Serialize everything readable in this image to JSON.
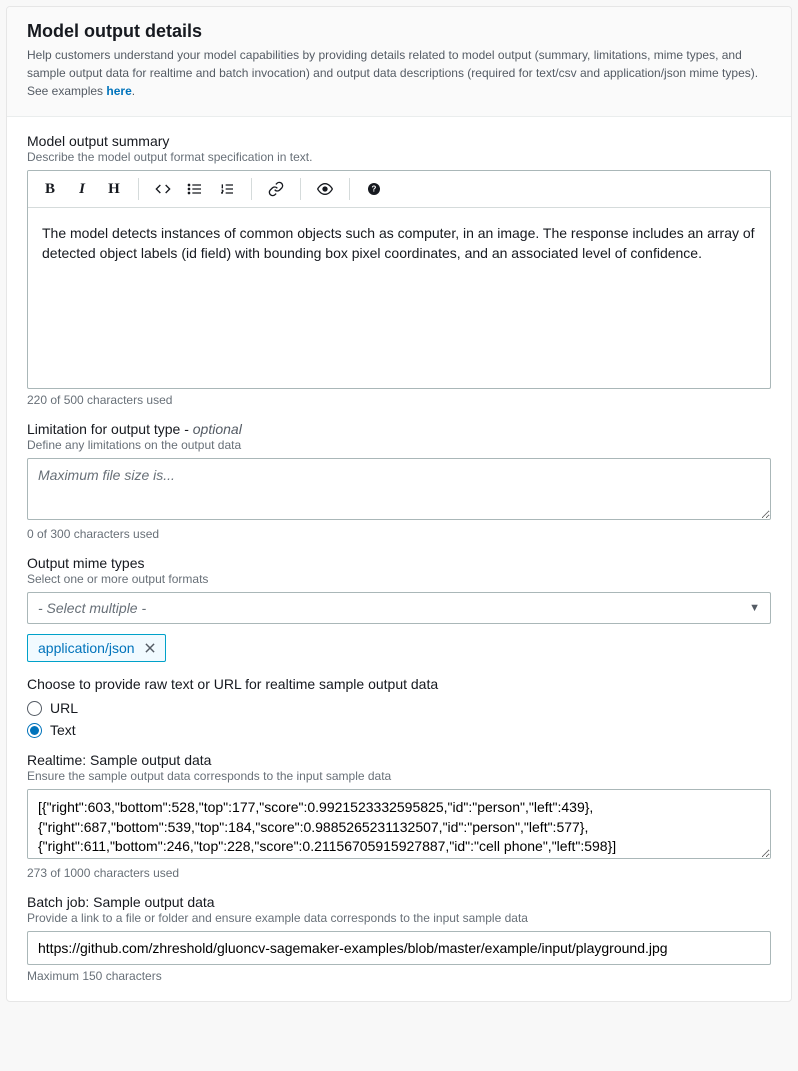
{
  "header": {
    "title": "Model output details",
    "desc_pre": "Help customers understand your model capabilities by providing details related to model output (summary, limitations, mime types, and sample output data for realtime and batch invocation) and output data descriptions (required for text/csv and application/json mime types). See examples ",
    "link": "here",
    "desc_post": "."
  },
  "summary": {
    "label": "Model output summary",
    "hint": "Describe the model output format specification in text.",
    "value": "The model detects instances of common objects such as computer, in an image. The response includes an array of detected object labels (id field) with bounding box pixel coordinates, and an associated level of confidence.",
    "count": "220 of 500 characters used"
  },
  "limitation": {
    "label_pre": "Limitation for output type - ",
    "optional": "optional",
    "hint": "Define any limitations on the output data",
    "placeholder": "Maximum file size is...",
    "count": "0 of 300 characters used"
  },
  "mime": {
    "label": "Output mime types",
    "hint": "Select one or more output formats",
    "placeholder": "- Select multiple -",
    "selected": "application/json"
  },
  "source": {
    "label": "Choose to provide raw text or URL for realtime sample output data",
    "option_url": "URL",
    "option_text": "Text",
    "selected": "text"
  },
  "realtime": {
    "label": "Realtime: Sample output data",
    "hint": "Ensure the sample output data corresponds to the input sample data",
    "value": "[{\"right\":603,\"bottom\":528,\"top\":177,\"score\":0.9921523332595825,\"id\":\"person\",\"left\":439},{\"right\":687,\"bottom\":539,\"top\":184,\"score\":0.9885265231132507,\"id\":\"person\",\"left\":577},{\"right\":611,\"bottom\":246,\"top\":228,\"score\":0.21156705915927887,\"id\":\"cell phone\",\"left\":598}]",
    "count": "273 of 1000 characters used"
  },
  "batch": {
    "label": "Batch job: Sample output data",
    "hint": "Provide a link to a file or folder and ensure example data corresponds to the input sample data",
    "value": "https://github.com/zhreshold/gluoncv-sagemaker-examples/blob/master/example/input/playground.jpg",
    "count": "Maximum 150 characters"
  }
}
